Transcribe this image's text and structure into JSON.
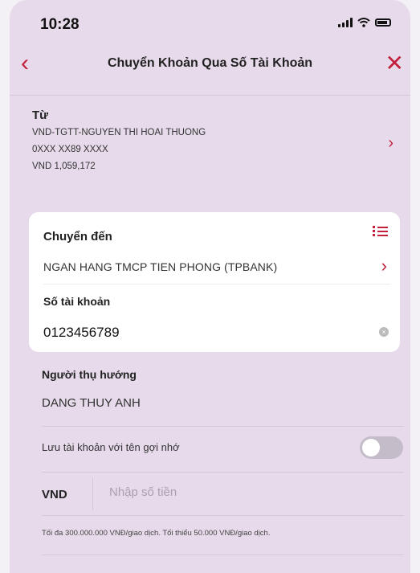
{
  "status_bar": {
    "time": "10:28"
  },
  "nav": {
    "back_icon": "‹",
    "title": "Chuyển Khoản Qua Số Tài Khoản",
    "close_icon": "✕"
  },
  "from": {
    "label": "Từ",
    "account_name": "VND-TGTT-NGUYEN THI HOAI THUONG",
    "account_number": "0XXX XX89 XXXX",
    "balance": "VND 1,059,172",
    "chevron": "›"
  },
  "to": {
    "label": "Chuyển đến",
    "bank": "NGAN HANG TMCP TIEN PHONG (TPBANK)",
    "chevron": "›",
    "account_label": "Số tài khoản",
    "account_value": "0123456789"
  },
  "payee": {
    "label": "Người thụ hướng",
    "name": "DANG THUY ANH"
  },
  "save": {
    "label": "Lưu tài khoản với tên gợi nhớ",
    "enabled": false
  },
  "amount": {
    "currency": "VND",
    "placeholder": "Nhập số tiền",
    "value": ""
  },
  "limit_note": "Tối đa 300.000.000 VNĐ/giao dịch. Tối thiểu 50.000 VNĐ/giao dịch.",
  "colors": {
    "accent": "#c2203d",
    "background": "#e7dbeb",
    "card": "#ffffff"
  }
}
